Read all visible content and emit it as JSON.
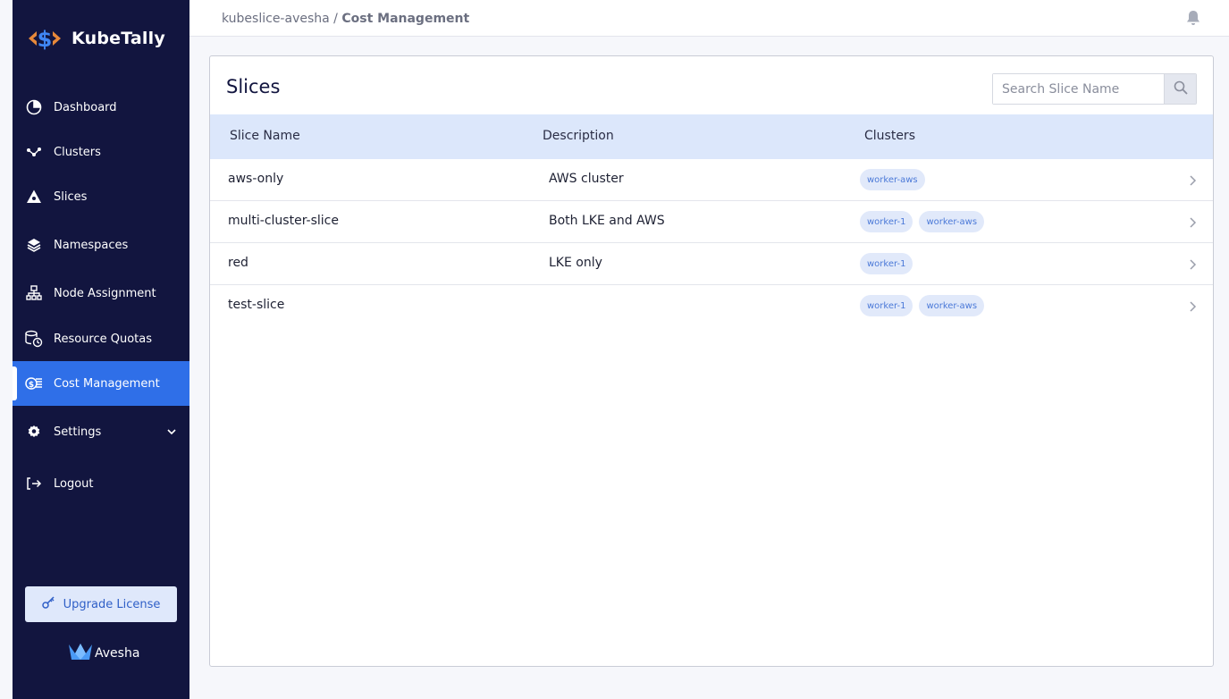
{
  "app": {
    "brand_name": "KubeTally",
    "accent_color": "#2f6fe8",
    "sidebar_color": "#12153f"
  },
  "breadcrumb": {
    "parent": "kubeslice-avesha",
    "separator": "/",
    "current": "Cost Management"
  },
  "sidebar": {
    "items": [
      {
        "label": "Dashboard",
        "icon": "pie-chart-icon"
      },
      {
        "label": "Clusters",
        "icon": "clusters-icon"
      },
      {
        "label": "Slices",
        "icon": "slices-icon"
      },
      {
        "label": "Namespaces",
        "icon": "layers-icon"
      },
      {
        "label": "Node Assignment",
        "icon": "hierarchy-icon"
      },
      {
        "label": "Resource Quotas",
        "icon": "quota-icon"
      },
      {
        "label": "Cost Management",
        "icon": "cost-icon",
        "active": true
      },
      {
        "label": "Settings",
        "icon": "gear-icon",
        "expandable": true
      },
      {
        "label": "Logout",
        "icon": "logout-icon"
      }
    ],
    "upgrade_label": "Upgrade License",
    "footer_brand": "Avesha"
  },
  "main": {
    "title": "Slices",
    "search": {
      "placeholder": "Search Slice Name",
      "value": ""
    },
    "table": {
      "columns": [
        "Slice Name",
        "Description",
        "Clusters"
      ],
      "rows": [
        {
          "name": "aws-only",
          "description": "AWS cluster",
          "clusters": [
            "worker-aws"
          ]
        },
        {
          "name": "multi-cluster-slice",
          "description": "Both LKE and AWS",
          "clusters": [
            "worker-1",
            "worker-aws"
          ]
        },
        {
          "name": "red",
          "description": "LKE only",
          "clusters": [
            "worker-1"
          ]
        },
        {
          "name": "test-slice",
          "description": "",
          "clusters": [
            "worker-1",
            "worker-aws"
          ]
        }
      ]
    }
  }
}
